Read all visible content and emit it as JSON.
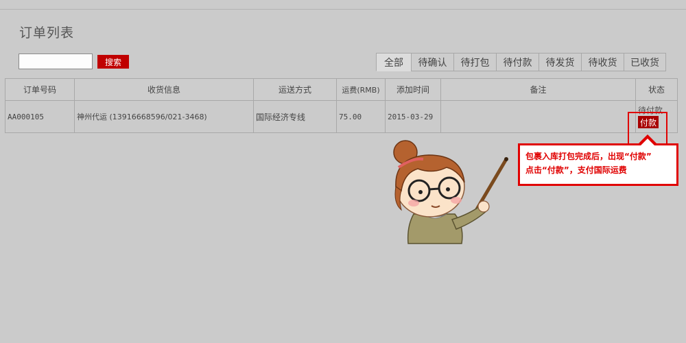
{
  "page": {
    "title": "订单列表"
  },
  "search": {
    "value": "",
    "placeholder": "",
    "button_label": "搜索"
  },
  "tabs": [
    {
      "label": "全部",
      "active": true
    },
    {
      "label": "待确认",
      "active": false
    },
    {
      "label": "待打包",
      "active": false
    },
    {
      "label": "待付款",
      "active": false
    },
    {
      "label": "待发货",
      "active": false
    },
    {
      "label": "待收货",
      "active": false
    },
    {
      "label": "已收货",
      "active": false
    }
  ],
  "table": {
    "headers": [
      "订单号码",
      "收货信息",
      "运送方式",
      "运费(RMB)",
      "添加时间",
      "备注",
      "状态"
    ],
    "rows": [
      {
        "order_no": "AA000105",
        "receiver": "神州代运 (13916668596/021-3468)",
        "shipping": "国际经济专线",
        "fee": "75.00",
        "date": "2015-03-29",
        "remark": "",
        "status": "待付款",
        "action": "付款"
      }
    ]
  },
  "callout": {
    "line1": "包裹入库打包完成后，出现“付款”",
    "line2": "点击“付款”，支付国际运费"
  },
  "colors": {
    "background": "#cbcbcb",
    "accent": "#c00000",
    "callout_border": "#e00000",
    "link": "#0000cc"
  },
  "icons": {
    "mascot": "girl-with-pointer-illustration"
  }
}
